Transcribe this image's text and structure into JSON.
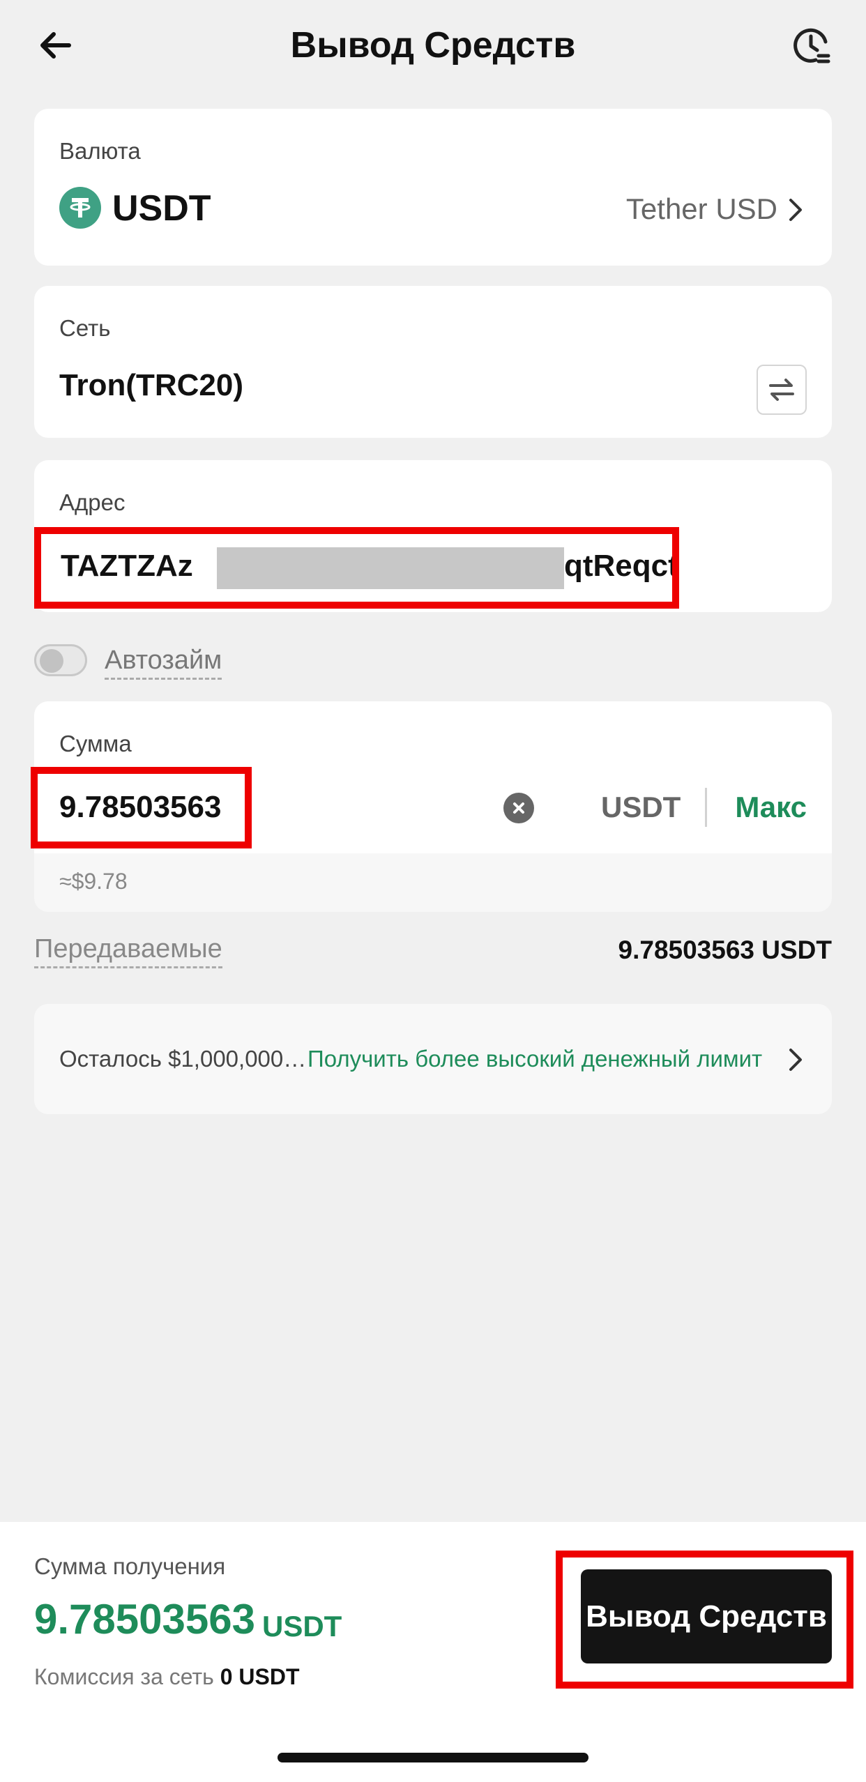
{
  "header": {
    "title": "Вывод Средств",
    "back_icon": "arrow-left-icon",
    "history_icon": "clock-history-icon"
  },
  "currency": {
    "label": "Валюта",
    "symbol": "USDT",
    "full_name": "Tether USD",
    "coin_icon": "tether-icon",
    "coin_icon_color": "#3fa184"
  },
  "network": {
    "label": "Сеть",
    "value": "Tron(TRC20)",
    "swap_icon": "swap-arrows-icon"
  },
  "address": {
    "label": "Адрес",
    "prefix": "TAZTZAz",
    "suffix": "qtReqct"
  },
  "autoloan": {
    "label": "Автозайм",
    "enabled": false
  },
  "amount": {
    "label": "Сумма",
    "value": "9.78503563",
    "currency": "USDT",
    "max_label": "Макс",
    "usd_equivalent": "≈$9.78"
  },
  "transfer": {
    "label": "Передаваемые",
    "value": "9.78503563 USDT"
  },
  "limit": {
    "remaining": "Осталось  $1,000,000…",
    "link": "Получить более высокий денежный лимит"
  },
  "footer": {
    "receive_label": "Сумма получения",
    "receive_value": "9.78503563",
    "receive_unit": "USDT",
    "fee_label": "Комиссия за сеть",
    "fee_value": "0 USDT",
    "withdraw_button": "Вывод Средств"
  },
  "colors": {
    "accent_green": "#1e8c5a",
    "highlight_red": "#ee0000",
    "button_dark": "#141414"
  }
}
